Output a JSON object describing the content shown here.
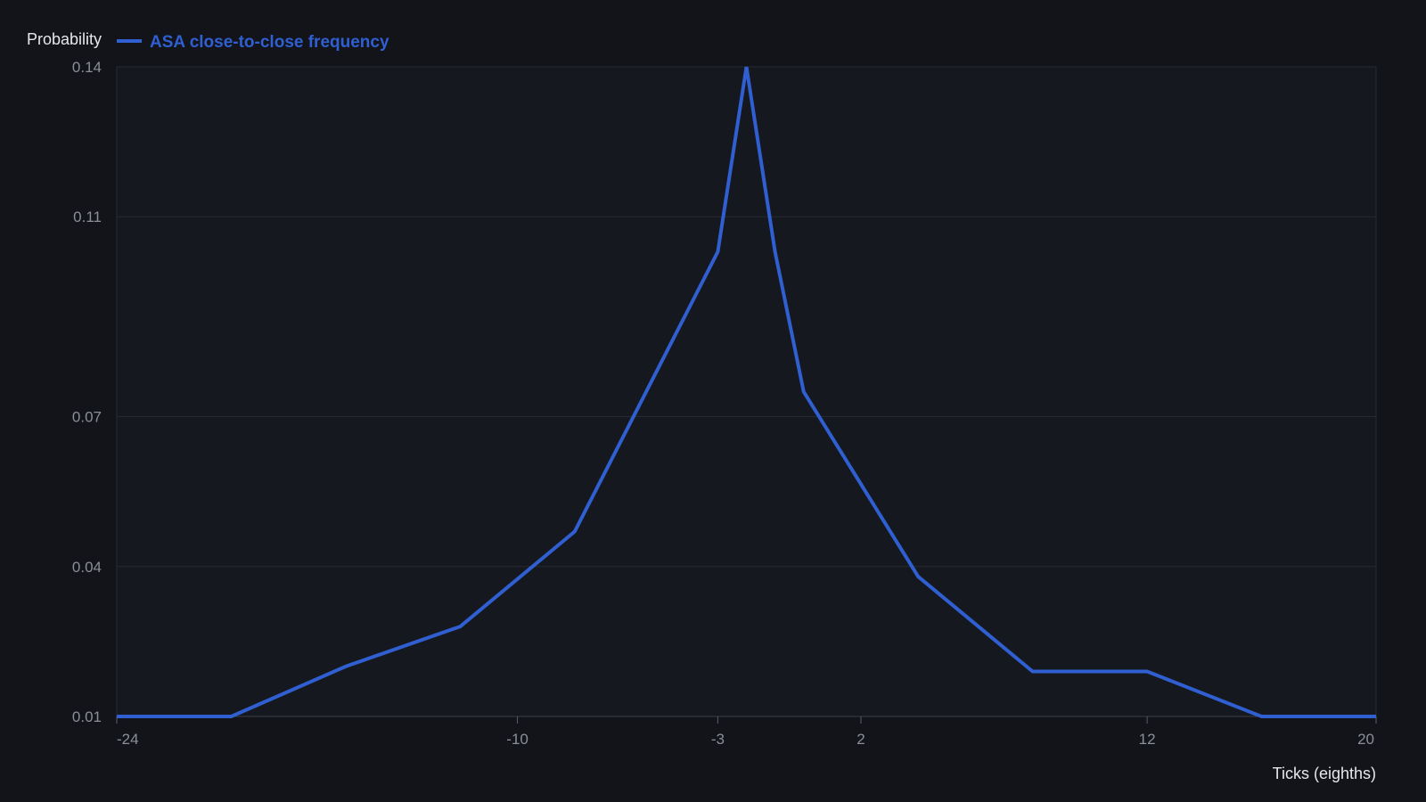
{
  "chart_data": {
    "type": "line",
    "ylabel": "Probability",
    "xlabel": "Ticks (eighths)",
    "xlim": [
      -24,
      20
    ],
    "ylim": [
      0.01,
      0.14
    ],
    "xticks": [
      -24,
      -10,
      -3,
      2,
      12,
      20
    ],
    "yticks": [
      0.01,
      0.04,
      0.07,
      0.11,
      0.14
    ],
    "grid": true,
    "legend": "top-left",
    "colors": {
      "background": "#121419",
      "plot_background": "#15181e",
      "grid": "#262a31",
      "series": "#2f5fd0"
    },
    "series": [
      {
        "name": "ASA close-to-close frequency",
        "x": [
          -24,
          -20,
          -16,
          -12,
          -8,
          -3,
          -2,
          -1,
          0,
          4,
          8,
          12,
          16,
          20
        ],
        "y": [
          0.01,
          0.01,
          0.02,
          0.028,
          0.047,
          0.103,
          0.14,
          0.103,
          0.075,
          0.038,
          0.019,
          0.019,
          0.01,
          0.01
        ]
      }
    ]
  }
}
